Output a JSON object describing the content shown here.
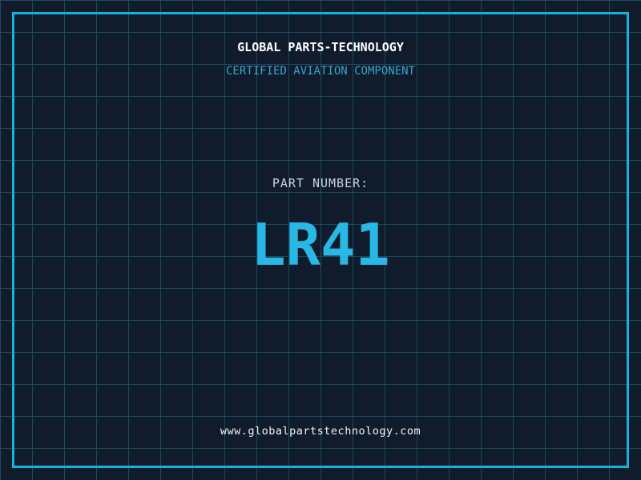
{
  "label": {
    "title": "GLOBAL PARTS-TECHNOLOGY",
    "subtitle": "CERTIFIED AVIATION COMPONENT",
    "part_number_label": "PART NUMBER:",
    "part_number": "LR41",
    "website": "www.globalpartstechnology.com"
  },
  "colors": {
    "background": "#101b2c",
    "grid_line": "#1d4a60",
    "frame": "#18b0de",
    "title_text": "#ffffff",
    "subtitle_text": "#35a6cc",
    "label_text": "#c9d2db",
    "part_number_text": "#29b8e6",
    "website_text": "#f0f4f8"
  }
}
